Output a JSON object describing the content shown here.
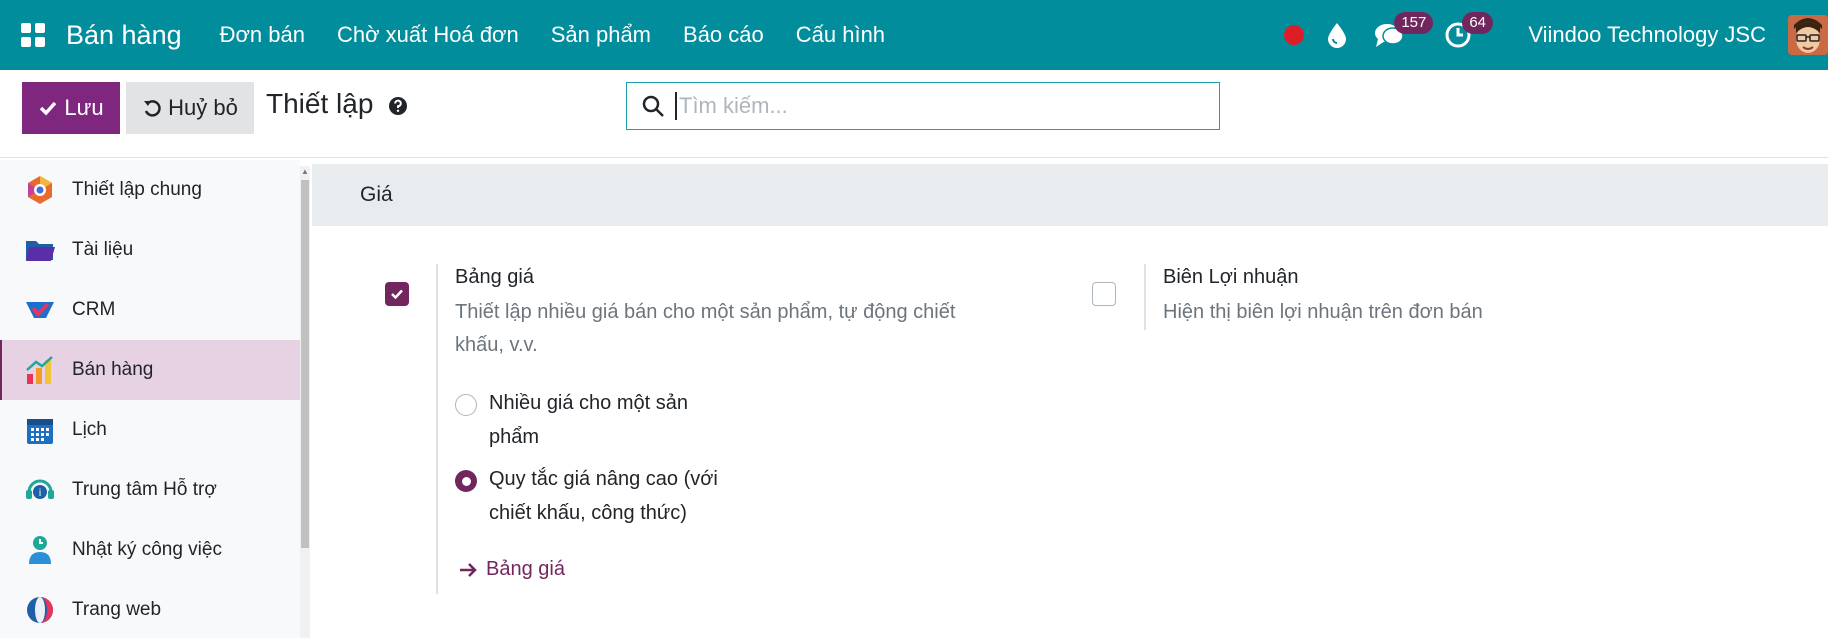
{
  "navbar": {
    "brand": "Bán hàng",
    "menu": [
      {
        "label": "Đơn bán"
      },
      {
        "label": "Chờ xuất Hoá đơn"
      },
      {
        "label": "Sản phẩm"
      },
      {
        "label": "Báo cáo"
      },
      {
        "label": "Cấu hình"
      }
    ],
    "messages_count": "157",
    "activities_count": "64",
    "company": "Viindoo Technology JSC",
    "colors": {
      "bar": "#018d9b",
      "badge": "#71275e",
      "record": "#dc1e28"
    }
  },
  "control": {
    "save_label": "Lưu",
    "discard_label": "Huỷ bỏ",
    "title": "Thiết lập",
    "search_placeholder": "Tìm kiếm..."
  },
  "sidebar": {
    "items": [
      {
        "label": "Thiết lập chung",
        "icon": "general-settings-icon"
      },
      {
        "label": "Tài liệu",
        "icon": "folder-icon"
      },
      {
        "label": "CRM",
        "icon": "crm-icon"
      },
      {
        "label": "Bán hàng",
        "icon": "sales-chart-icon",
        "active": true
      },
      {
        "label": "Lịch",
        "icon": "calendar-icon"
      },
      {
        "label": "Trung tâm Hỗ trợ",
        "icon": "helpdesk-icon"
      },
      {
        "label": "Nhật ký công việc",
        "icon": "timesheet-icon"
      },
      {
        "label": "Trang web",
        "icon": "website-icon"
      }
    ]
  },
  "main": {
    "section_title": "Giá",
    "pricelist": {
      "checked": true,
      "title": "Bảng giá",
      "description_line1": "Thiết lập nhiều giá bán cho một sản phẩm, tự động chiết",
      "description_line2": "khấu, v.v.",
      "options": [
        {
          "line1": "Nhiều giá cho một sản",
          "line2": "phẩm",
          "selected": false
        },
        {
          "line1": "Quy tắc giá nâng cao (với",
          "line2": "chiết khấu, công thức)",
          "selected": true
        }
      ],
      "link_label": "Bảng giá"
    },
    "margins": {
      "checked": false,
      "title": "Biên Lợi nhuận",
      "description": "Hiện thị biên lợi nhuận trên đơn bán"
    }
  }
}
